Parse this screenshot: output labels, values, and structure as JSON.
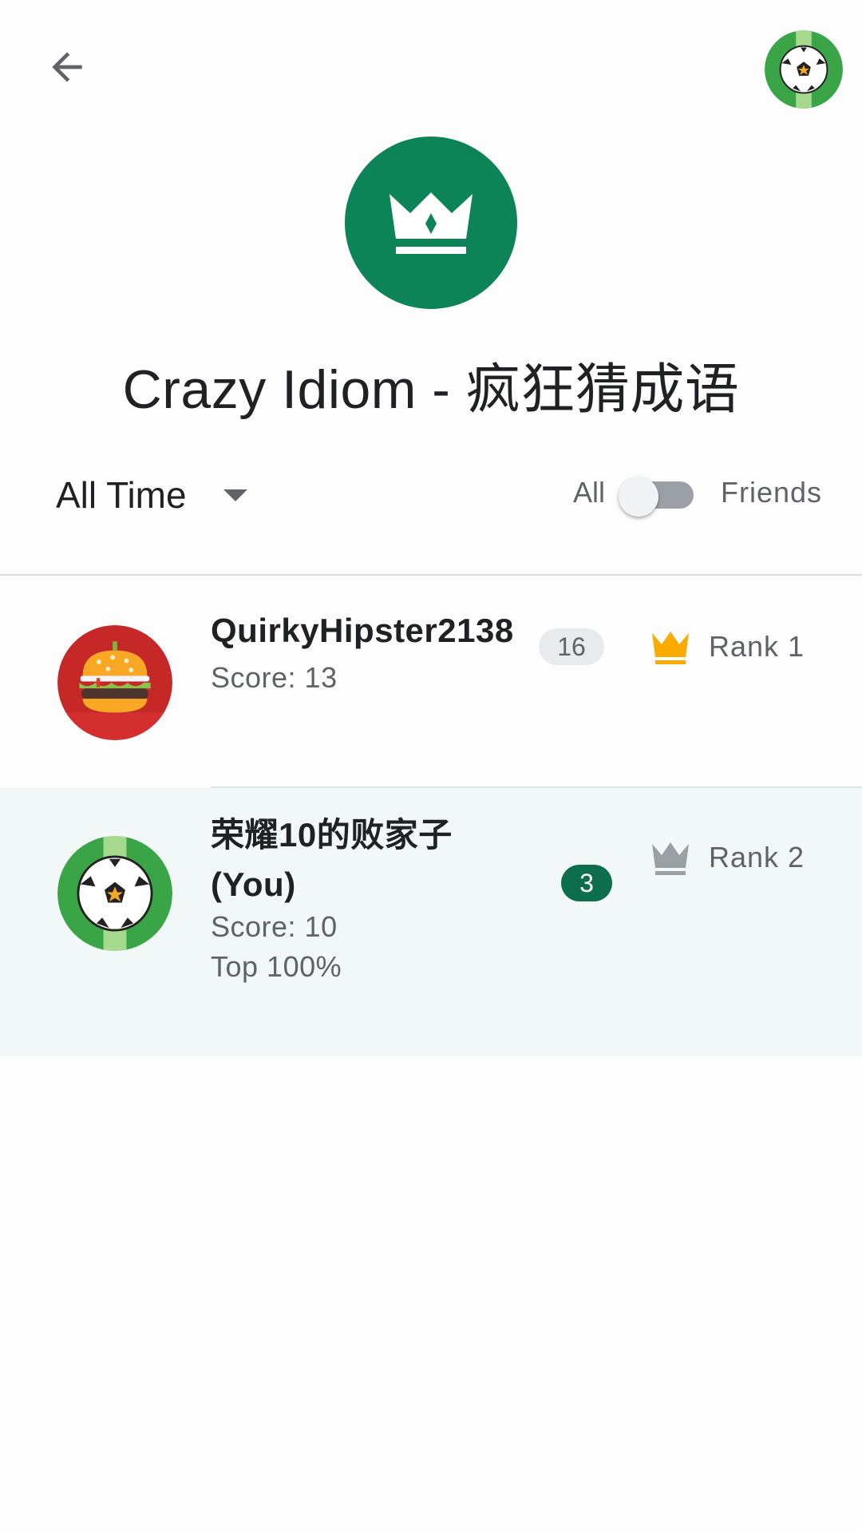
{
  "header": {
    "back_icon": "arrow-back-icon",
    "game_icon": "crown-icon",
    "game_title": "Crazy Idiom - 疯狂猜成语",
    "accent_color": "#0c8457"
  },
  "filters": {
    "time_range": "All Time",
    "toggle_left_label": "All",
    "toggle_right_label": "Friends",
    "toggle_selected": "All"
  },
  "leaderboard": [
    {
      "name": "QuirkyHipster2138",
      "name_line2": "",
      "level": "16",
      "score_text": "Score: 13",
      "extra_text": "",
      "rank_text": "Rank 1",
      "avatar_icon": "burger-avatar-icon",
      "crown_color": "#f9ab00"
    },
    {
      "name": "荣耀10的败家子",
      "name_line2": "(You)",
      "level": "3",
      "score_text": "Score: 10",
      "extra_text": "Top 100%",
      "rank_text": "Rank 2",
      "avatar_icon": "soccer-ball-avatar-icon",
      "crown_color": "#9aa0a6"
    }
  ]
}
